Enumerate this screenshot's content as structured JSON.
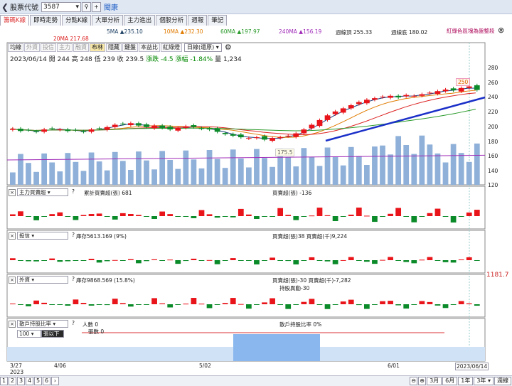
{
  "toolbar": {
    "label": "股票代號",
    "code": "3587",
    "search_icon": "search-icon",
    "add_icon": "plus-icon",
    "name": "閎康"
  },
  "tabs": [
    "籌碼K線",
    "即時走勢",
    "分點K線",
    "大單分析",
    "主力進出",
    "個股分析",
    "週報",
    "筆記"
  ],
  "ma": [
    "5MA ▲235.10",
    "10MA ▲232.30",
    "60MA ▲197.97",
    "240MA ▲156.19",
    "週線頂 255.33",
    "週線底 180.02",
    "20MA 217.68"
  ],
  "red_note": "紅綠色區塊為盤整段",
  "buttons": [
    "均線",
    "外資",
    "投信",
    "主力",
    "融資",
    "布林",
    "隱藏",
    "鍵盤",
    "本益比",
    "紅綠燈"
  ],
  "period": "日線(還原)",
  "quote": {
    "date": "2023/06/14",
    "open_l": "開",
    "open": "244",
    "high_l": "高",
    "high": "248",
    "low_l": "低",
    "low": "239",
    "close_l": "收",
    "close": "239.5",
    "chg_l": "漲跌",
    "chg": "-4.5",
    "pct_l": "漲幅",
    "pct": "-1.84%",
    "vol_l": "量",
    "vol": "1,234"
  },
  "annot": {
    "hi": "250",
    "lo": "175.5"
  },
  "y_main": [
    "280",
    "260",
    "240",
    "220",
    "200",
    "180",
    "160",
    "140",
    "120"
  ],
  "panel1": {
    "sel": "主力買賣超",
    "a": "累計買賣超(張) 681",
    "b": "買賣超(張) -136"
  },
  "panel2": {
    "sel": "投信",
    "a": "庫存5613.169 (9%)",
    "b": "買賣超(張)38 買賣超(千)9,224",
    "mark": "1181.7"
  },
  "panel3": {
    "sel": "外資",
    "a": "庫存9868.569 (15.8%)",
    "b": "買賣超(張)-30 買賣超(千)-7,282",
    "c": "持股異動-30"
  },
  "panel4": {
    "sel": "散戶持股比率",
    "num": "100",
    "btn": "張以下",
    "a": "人數 0",
    "b": "張數 0",
    "c": "散戶持股比率 0%"
  },
  "xticks": [
    "3/27",
    "4/06",
    "5/02",
    "6/01",
    "2023/06/14"
  ],
  "year": "2023",
  "pages": [
    "1",
    "2",
    "3",
    "4",
    "5",
    "6"
  ],
  "ranges": [
    "3月",
    "6月",
    "1年",
    "3年",
    "週線"
  ],
  "colors": {
    "up": "#e8141a",
    "down": "#0a8a28",
    "vol": "#8fb0d8",
    "trend": "#1a2fc8"
  },
  "chart_data": {
    "type": "candlestick",
    "y_range": [
      120,
      280
    ],
    "closes": [
      190,
      187,
      188,
      186,
      189,
      190,
      189,
      187,
      188,
      186,
      189,
      190,
      192,
      195,
      196,
      197,
      194,
      192,
      194,
      191,
      189,
      191,
      193,
      192,
      190,
      189,
      186,
      183,
      181,
      179,
      178,
      179,
      176,
      178,
      179,
      181,
      184,
      189,
      195,
      201,
      207,
      212,
      216,
      220,
      224,
      227,
      229,
      231,
      232,
      230,
      233,
      232,
      234,
      236,
      238,
      240,
      239,
      242,
      244,
      239.5
    ]
  }
}
